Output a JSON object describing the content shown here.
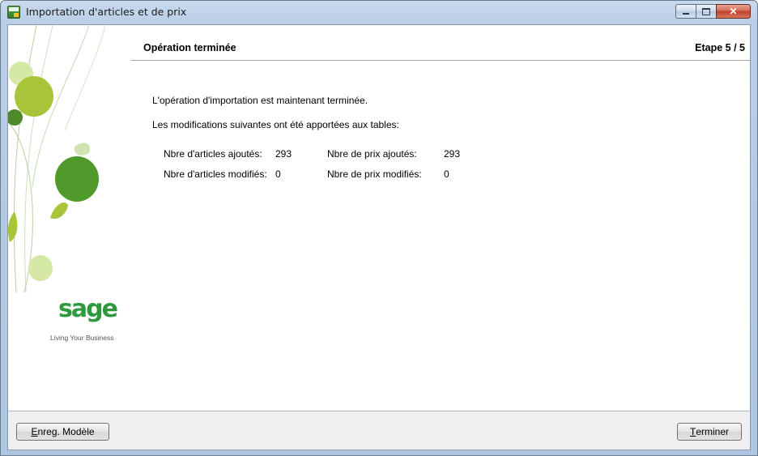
{
  "window": {
    "title": "Importation d'articles et de prix",
    "icons": {
      "app": "sage-app-icon",
      "minimize": "minimize-icon",
      "maximize": "maximize-icon",
      "close": "close-icon"
    }
  },
  "header": {
    "title": "Opération terminée",
    "step": "Etape  5 / 5"
  },
  "side": {
    "logo": "sage",
    "tagline": "Living Your Business"
  },
  "content": {
    "line1": "L'opération d'importation est maintenant terminée.",
    "line2": "Les modifications suivantes ont été apportées aux tables:",
    "stats": [
      {
        "label": "Nbre d'articles ajoutés:",
        "value": "293"
      },
      {
        "label": "Nbre d'articles modifiés:",
        "value": "0"
      },
      {
        "label": "Nbre de prix ajoutés:",
        "value": "293"
      },
      {
        "label": "Nbre de prix modifiés:",
        "value": "0"
      }
    ]
  },
  "footer": {
    "save_template_first": "E",
    "save_template_rest": "nreg. Modèle",
    "finish_first": "T",
    "finish_rest": "erminer"
  },
  "colors": {
    "leaf_light": "#a8c43a",
    "leaf_dark": "#4f9a2a",
    "brand_green": "#2e9a3e"
  }
}
